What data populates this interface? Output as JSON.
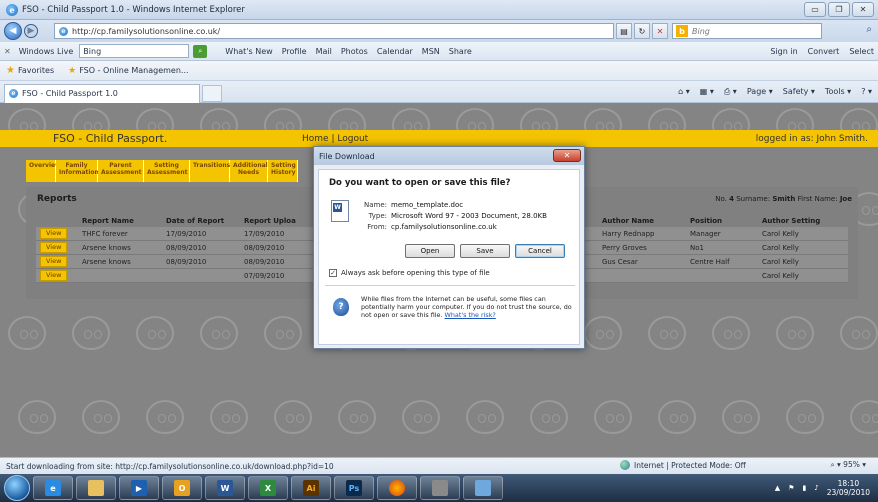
{
  "window": {
    "title": "FSO - Child Passport 1.0 - Windows Internet Explorer",
    "address": "http://cp.familysolutionsonline.co.uk/",
    "search_placeholder": "Bing",
    "tab_title": "FSO - Child Passport 1.0"
  },
  "live_bar": {
    "brand": "Windows Live",
    "search_value": "Bing",
    "links": [
      "What's New",
      "Profile",
      "Mail",
      "Photos",
      "Calendar",
      "MSN",
      "Share"
    ],
    "sign_in": "Sign in",
    "convert": "Convert",
    "select": "Select"
  },
  "favorites": {
    "label": "Favorites",
    "item": "FSO - Online Managemen..."
  },
  "command_bar": [
    "Page ▾",
    "Safety ▾",
    "Tools ▾"
  ],
  "app": {
    "brand": "FSO - Child Passport.",
    "home_link": "Home",
    "separator": "|",
    "logout_link": "Logout",
    "logged_in": "logged in as: John Smith."
  },
  "nav_tabs": [
    {
      "label": "Overview"
    },
    {
      "label": "Family Information"
    },
    {
      "label": "Parent Assessment"
    },
    {
      "label": "Setting Assessment"
    },
    {
      "label": "Transitions"
    },
    {
      "label": "Additional Needs"
    },
    {
      "label": "Setting History"
    }
  ],
  "reports": {
    "title": "Reports",
    "patient_no_label": "No.",
    "patient_no": "4",
    "surname_label": "Surname:",
    "surname": "Smith",
    "firstname_label": "First Name:",
    "firstname": "Joe",
    "view_label": "View",
    "columns": [
      "",
      "Report Name",
      "Date of Report",
      "Report Uploa",
      "Author Name",
      "Position",
      "Author Setting"
    ],
    "rows": [
      {
        "name": "THFC forever",
        "date": "17/09/2010",
        "upload": "17/09/2010",
        "author": "Harry Rednapp",
        "position": "Manager",
        "setting": "Carol Kelly"
      },
      {
        "name": "Arsene knows",
        "date": "08/09/2010",
        "upload": "08/09/2010",
        "author": "Perry Groves",
        "position": "No1",
        "setting": "Carol Kelly"
      },
      {
        "name": "Arsene knows",
        "date": "08/09/2010",
        "upload": "08/09/2010",
        "author": "Gus Cesar",
        "position": "Centre Half",
        "setting": "Carol Kelly"
      },
      {
        "name": "",
        "date": "",
        "upload": "07/09/2010",
        "author": "",
        "position": "",
        "setting": "Carol Kelly"
      }
    ]
  },
  "dialog": {
    "title": "File Download",
    "question": "Do you want to open or save this file?",
    "name_label": "Name:",
    "name": "memo_template.doc",
    "type_label": "Type:",
    "type": "Microsoft Word 97 - 2003 Document, 28.0KB",
    "from_label": "From:",
    "from": "cp.familysolutionsonline.co.uk",
    "open": "Open",
    "save": "Save",
    "cancel": "Cancel",
    "always_ask": "Always ask before opening this type of file",
    "warning": "While files from the Internet can be useful, some files can potentially harm your computer. If you do not trust the source, do not open or save this file.",
    "risk_link": "What's the risk?"
  },
  "status": {
    "text": "Start downloading from site: http://cp.familysolutionsonline.co.uk/download.php?id=10",
    "zone": "Internet | Protected Mode: Off",
    "zoom": "95%"
  },
  "taskbar": {
    "time": "18:10",
    "date": "23/09/2010"
  }
}
